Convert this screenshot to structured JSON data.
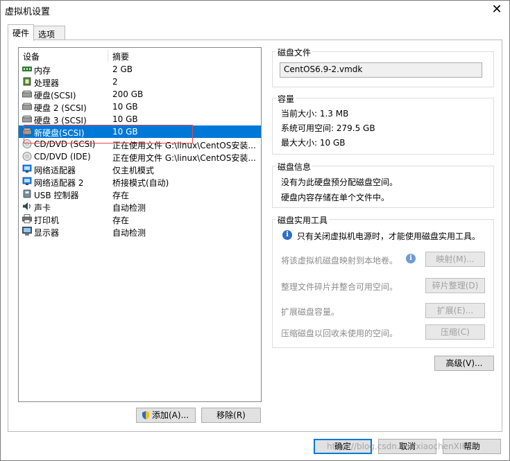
{
  "window": {
    "title": "虚拟机设置",
    "close": "✕"
  },
  "tabs": [
    {
      "label": "硬件"
    },
    {
      "label": "选项"
    }
  ],
  "devices": {
    "header": {
      "device": "设备",
      "summary": "摘要"
    },
    "rows": [
      {
        "name": "内存",
        "summary": "2 GB",
        "icon": "memory-icon"
      },
      {
        "name": "处理器",
        "summary": "2",
        "icon": "processor-icon"
      },
      {
        "name": "硬盘(SCSI)",
        "summary": "200 GB",
        "icon": "hard-disk-icon"
      },
      {
        "name": "硬盘 2 (SCSI)",
        "summary": "10 GB",
        "icon": "hard-disk-icon"
      },
      {
        "name": "硬盘 3 (SCSI)",
        "summary": "10 GB",
        "icon": "hard-disk-icon"
      },
      {
        "name": "新硬盘(SCSI)",
        "summary": "10 GB",
        "icon": "hard-disk-icon",
        "selected": true
      },
      {
        "name": "CD/DVD (SCSI)",
        "summary": "正在使用文件 G:\\linux\\CentOS安装...",
        "icon": "cd-dvd-icon"
      },
      {
        "name": "CD/DVD (IDE)",
        "summary": "正在使用文件 G:\\linux\\CentOS安装...",
        "icon": "cd-dvd-icon"
      },
      {
        "name": "网络适配器",
        "summary": "仅主机模式",
        "icon": "network-adapter-icon"
      },
      {
        "name": "网络适配器 2",
        "summary": "桥接模式(自动)",
        "icon": "network-adapter-icon"
      },
      {
        "name": "USB 控制器",
        "summary": "存在",
        "icon": "usb-icon"
      },
      {
        "name": "声卡",
        "summary": "自动检测",
        "icon": "sound-card-icon"
      },
      {
        "name": "打印机",
        "summary": "存在",
        "icon": "printer-icon"
      },
      {
        "name": "显示器",
        "summary": "自动检测",
        "icon": "display-icon"
      }
    ],
    "add_button": "添加(A)...",
    "remove_button": "移除(R)"
  },
  "disk_file": {
    "title": "磁盘文件",
    "value": "CentOS6.9-2.vmdk"
  },
  "capacity": {
    "title": "容量",
    "current": "当前大小: 1.3 MB",
    "available": "系统可用空间: 279.5 GB",
    "max": "最大大小: 10 GB"
  },
  "disk_info": {
    "title": "磁盘信息",
    "line1": "没有为此硬盘预分配磁盘空间。",
    "line2": "硬盘内容存储在单个文件中。"
  },
  "utilities": {
    "title": "磁盘实用工具",
    "notice": "只有关闭虚拟机电源时，才能使用磁盘实用工具。",
    "map_text": "将该虚拟机磁盘映射到本地卷。",
    "map_button": "映射(M)...",
    "defrag_text": "整理文件碎片并整合可用空间。",
    "defrag_button": "碎片整理(D)",
    "expand_text": "扩展磁盘容量。",
    "expand_button": "扩展(E)...",
    "compact_text": "压缩磁盘以回收未使用的空间。",
    "compact_button": "压缩(C)"
  },
  "advanced_button": "高级(V)...",
  "footer": {
    "ok": "确定",
    "cancel": "取消",
    "help": "帮助"
  },
  "watermark": "https://blog.csdn.net/xiaochenXIHUA"
}
